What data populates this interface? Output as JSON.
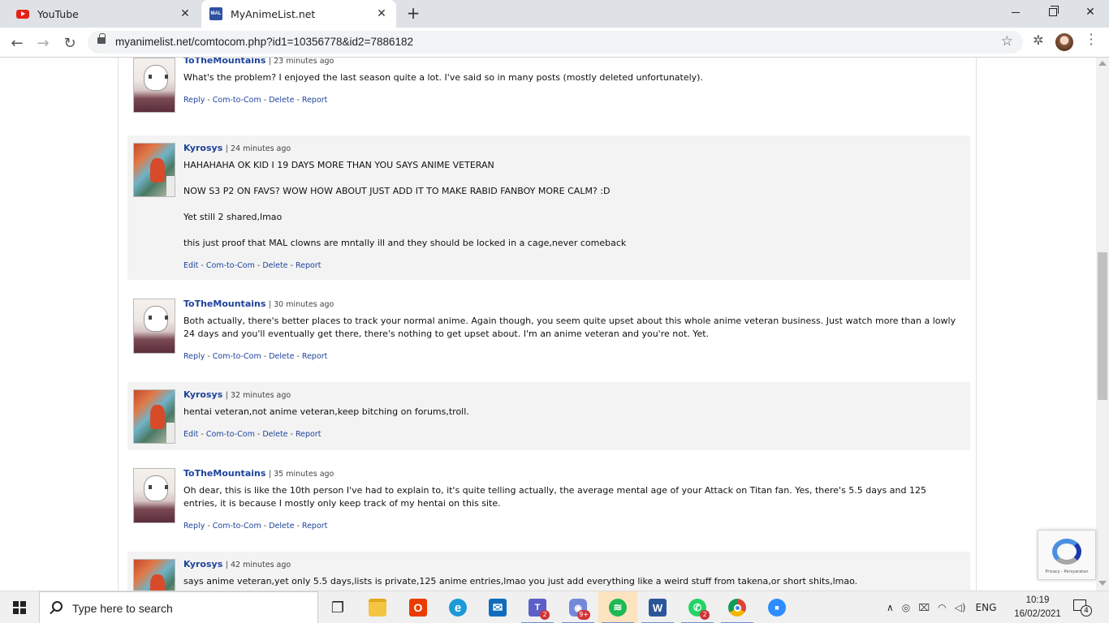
{
  "browser": {
    "tabs": [
      {
        "title": "YouTube",
        "close": "✕"
      },
      {
        "title": "MyAnimeList.net",
        "close": "✕"
      }
    ],
    "new_tab": "+",
    "url": "myanimelist.net/comtocom.php?id1=10356778&id2=7886182"
  },
  "comments": [
    {
      "user": "ToTheMountains",
      "time": "| 23 minutes ago",
      "paragraphs": [
        "What's the problem? I enjoyed the last season quite a lot. I've said so in many posts (mostly deleted unfortunately)."
      ],
      "actions": [
        "Reply",
        "Com-to-Com",
        "Delete",
        "Report"
      ]
    },
    {
      "user": "Kyrosys",
      "time": "| 24 minutes ago",
      "paragraphs": [
        "HAHAHAHA OK KID I 19 DAYS MORE THAN YOU SAYS ANIME VETERAN",
        "NOW S3 P2 ON FAVS? WOW HOW ABOUT JUST ADD IT TO MAKE RABID FANBOY MORE CALM? :D",
        "Yet still 2 shared,lmao",
        "this just proof that MAL clowns are mntally ill and they should be locked in a cage,never comeback"
      ],
      "actions": [
        "Edit",
        "Com-to-Com",
        "Delete",
        "Report"
      ]
    },
    {
      "user": "ToTheMountains",
      "time": "| 30 minutes ago",
      "paragraphs": [
        "Both actually, there's better places to track your normal anime. Again though, you seem quite upset about this whole anime veteran business. Just watch more than a lowly 24 days and you'll eventually get there, there's nothing to get upset about. I'm an anime veteran and you're not. Yet."
      ],
      "actions": [
        "Reply",
        "Com-to-Com",
        "Delete",
        "Report"
      ]
    },
    {
      "user": "Kyrosys",
      "time": "| 32 minutes ago",
      "paragraphs": [
        "hentai veteran,not anime veteran,keep bitching on forums,troll."
      ],
      "actions": [
        "Edit",
        "Com-to-Com",
        "Delete",
        "Report"
      ]
    },
    {
      "user": "ToTheMountains",
      "time": "| 35 minutes ago",
      "paragraphs": [
        "Oh dear, this is like the 10th person I've had to explain to, it's quite telling actually, the average mental age of your Attack on Titan fan. Yes, there's 5.5 days and 125 entries, it is because I mostly only keep track of my hentai on this site."
      ],
      "actions": [
        "Reply",
        "Com-to-Com",
        "Delete",
        "Report"
      ]
    },
    {
      "user": "Kyrosys",
      "time": "| 42 minutes ago",
      "paragraphs": [
        "says anime veteran,yet only 5.5 days,lists is private,125 anime entries,lmao you just add everything like a weird stuff from takena,or short shits,lmao."
      ],
      "actions": []
    }
  ],
  "recaptcha": {
    "links": "Privacy - Persyaratan"
  },
  "taskbar": {
    "search_placeholder": "Type here to search",
    "apps": [
      {
        "name": "task-view-icon",
        "glyph": "❐"
      },
      {
        "name": "file-explorer-icon",
        "glyph": ""
      },
      {
        "name": "office-icon",
        "glyph": "O"
      },
      {
        "name": "edge-icon",
        "glyph": "e"
      },
      {
        "name": "mail-icon",
        "glyph": "✉"
      },
      {
        "name": "teams-icon",
        "glyph": "T",
        "badge": "2"
      },
      {
        "name": "discord-icon",
        "glyph": "◉",
        "badge": "9+"
      },
      {
        "name": "spotify-icon",
        "glyph": "≋"
      },
      {
        "name": "word-icon",
        "glyph": "W"
      },
      {
        "name": "whatsapp-icon",
        "glyph": "✆",
        "badge": "2"
      },
      {
        "name": "chrome-icon",
        "glyph": ""
      },
      {
        "name": "zoom-icon",
        "glyph": "■"
      }
    ],
    "language": "ENG",
    "time": "10:19",
    "date": "16/02/2021",
    "notifications": "4"
  },
  "colors": {
    "username": "#1d439b",
    "alt_row": "#f3f3f3",
    "spotify_active": "#fde3bf"
  }
}
